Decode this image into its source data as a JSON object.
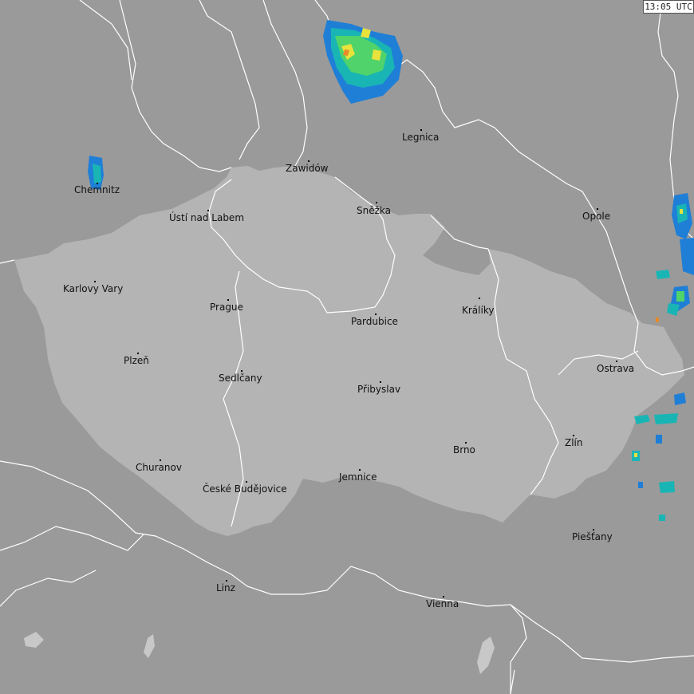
{
  "timestamp": "13:05 UTC",
  "colors": {
    "background": "#9a9a9a",
    "czech_republic": "#b4b4b4",
    "border": "#ffffff",
    "radar_blue": "#1f7fd6",
    "radar_cyan": "#19b5b5",
    "radar_green": "#4fd36a",
    "radar_yellow": "#e8e23c",
    "radar_orange": "#e88a2a"
  },
  "cities": [
    {
      "id": "chemnitz",
      "name": "Chemnitz"
    },
    {
      "id": "zawidow",
      "name": "Zawidów"
    },
    {
      "id": "legnica",
      "name": "Legnica"
    },
    {
      "id": "usti",
      "name": "Ústí nad Labem"
    },
    {
      "id": "snezka",
      "name": "Sněžka"
    },
    {
      "id": "opole",
      "name": "Opole"
    },
    {
      "id": "karlovy-vary",
      "name": "Karlovy Vary"
    },
    {
      "id": "prague",
      "name": "Prague"
    },
    {
      "id": "pardubice",
      "name": "Pardubice"
    },
    {
      "id": "kraliky",
      "name": "Králíky"
    },
    {
      "id": "plzen",
      "name": "Plzeň"
    },
    {
      "id": "sedlcany",
      "name": "Sedlčany"
    },
    {
      "id": "pribyslav",
      "name": "Přibyslav"
    },
    {
      "id": "ostrava",
      "name": "Ostrava"
    },
    {
      "id": "zlin",
      "name": "Zlín"
    },
    {
      "id": "brno",
      "name": "Brno"
    },
    {
      "id": "churanov",
      "name": "Churanov"
    },
    {
      "id": "ceske-budejovice",
      "name": "České Budějovice"
    },
    {
      "id": "jemnice",
      "name": "Jemnice"
    },
    {
      "id": "piestany",
      "name": "Piešťany"
    },
    {
      "id": "linz",
      "name": "Linz"
    },
    {
      "id": "vienna",
      "name": "Vienna"
    }
  ]
}
